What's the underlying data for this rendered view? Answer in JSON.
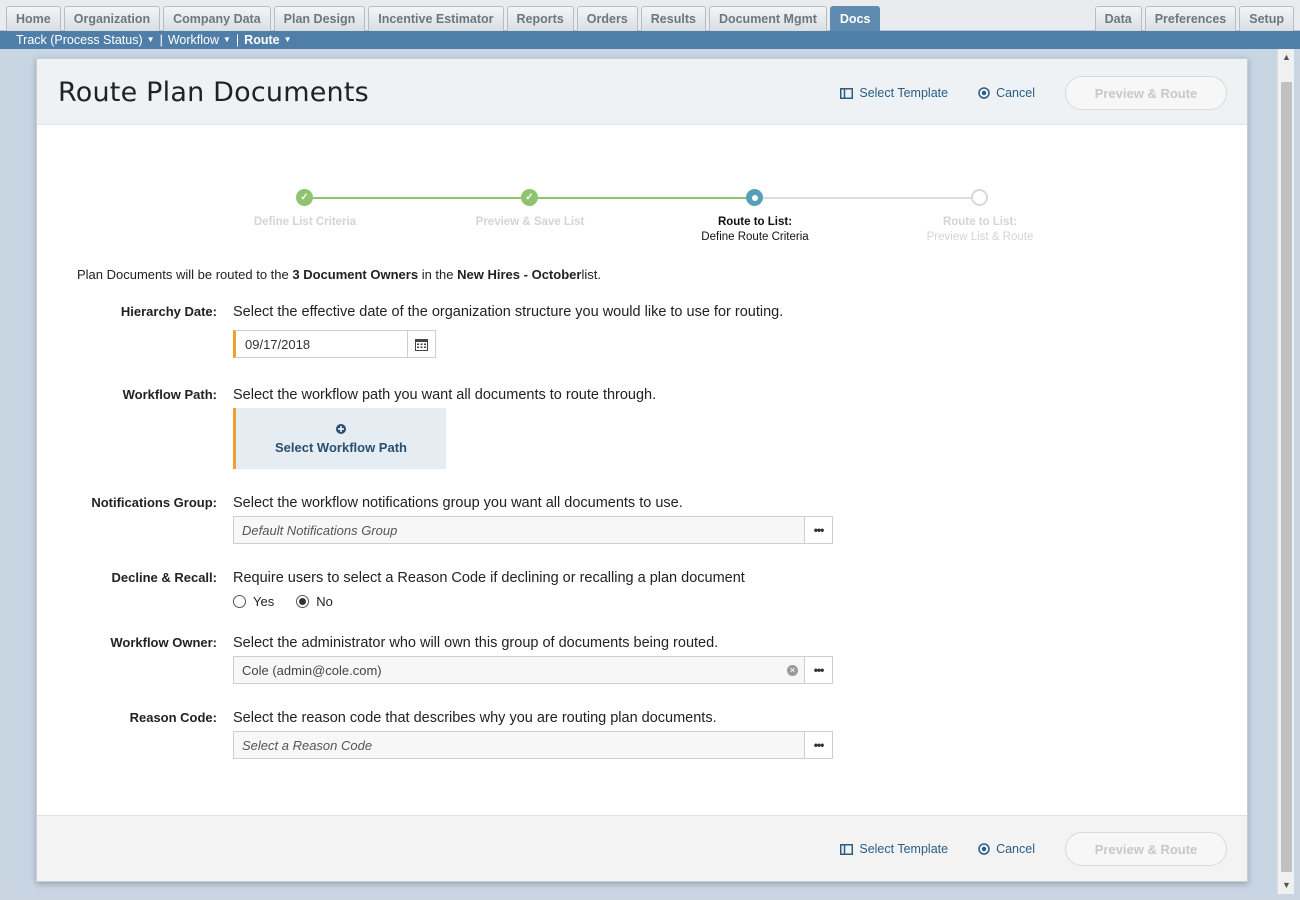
{
  "nav": {
    "tabs": [
      {
        "label": "Home"
      },
      {
        "label": "Organization"
      },
      {
        "label": "Company Data"
      },
      {
        "label": "Plan Design"
      },
      {
        "label": "Incentive Estimator"
      },
      {
        "label": "Reports"
      },
      {
        "label": "Orders"
      },
      {
        "label": "Results"
      },
      {
        "label": "Document Mgmt"
      },
      {
        "label": "Docs"
      }
    ],
    "active_tab": "Docs",
    "right_tabs": [
      {
        "label": "Data"
      },
      {
        "label": "Preferences"
      },
      {
        "label": "Setup"
      }
    ]
  },
  "subnav": {
    "items": [
      {
        "label": "Track (Process Status)"
      },
      {
        "label": "Workflow"
      },
      {
        "label": "Route"
      }
    ],
    "separator": "|"
  },
  "page": {
    "title": "Route Plan Documents",
    "select_template_label": "Select Template",
    "cancel_label": "Cancel",
    "preview_route_label": "Preview & Route"
  },
  "stepper": {
    "steps": [
      {
        "title": "Define List Criteria",
        "sub": "",
        "state": "done"
      },
      {
        "title": "Preview & Save List",
        "sub": "",
        "state": "done"
      },
      {
        "title": "Route to List:",
        "sub": "Define Route Criteria",
        "state": "current"
      },
      {
        "title": "Route to List:",
        "sub": "Preview List & Route",
        "state": "todo"
      }
    ]
  },
  "intro": {
    "prefix": "Plan Documents will be routed to the",
    "owners": "3 Document Owners",
    "middle": "in the",
    "list_name_a": "New Hires",
    "dash": "-",
    "list_name_b": "October",
    "suffix": "list."
  },
  "form": {
    "hierarchy_date": {
      "label": "Hierarchy Date:",
      "description": "Select the effective date of the organization structure you would like to use for routing.",
      "value": "09/17/2018"
    },
    "workflow_path": {
      "label": "Workflow Path:",
      "description": "Select the workflow path you want all documents to route through.",
      "button": "Select Workflow Path"
    },
    "notifications_group": {
      "label": "Notifications Group:",
      "description": "Select the workflow notifications group you want all documents to use.",
      "placeholder": "Default Notifications Group"
    },
    "decline_recall": {
      "label": "Decline & Recall:",
      "description": "Require users to select a Reason Code if declining or recalling a plan document",
      "options": [
        "Yes",
        "No"
      ],
      "selected": "No"
    },
    "workflow_owner": {
      "label": "Workflow Owner:",
      "description": "Select the administrator who will own this group of documents being routed.",
      "value": "Cole (admin@cole.com)"
    },
    "reason_code": {
      "label": "Reason Code:",
      "description": "Select the reason code that describes why you are routing plan documents.",
      "placeholder": "Select a Reason Code"
    }
  },
  "colors": {
    "accent": "#5f8bb0",
    "subnav": "#4f7ea8",
    "step_done": "#8fc36e",
    "step_current": "#5a9fba",
    "required_marker": "#f0a030",
    "link": "#2a5d86"
  }
}
